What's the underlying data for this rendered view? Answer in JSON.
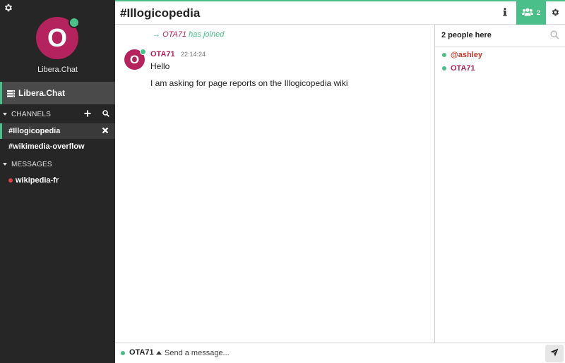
{
  "sidebar": {
    "avatar_letter": "O",
    "network_name": "Libera.Chat",
    "network_row_label": "Libera.Chat",
    "channels_header": "CHANNELS",
    "channels": [
      {
        "name": "#Illogicopedia",
        "active": true
      },
      {
        "name": "#wikimedia-overflow",
        "active": false
      }
    ],
    "messages_header": "MESSAGES",
    "queries": [
      {
        "name": "wikipedia-fr",
        "status_color": "#e04040"
      }
    ]
  },
  "header": {
    "channel_title": "#Illogicopedia",
    "people_count": "2"
  },
  "messages": {
    "join": {
      "nick": "OTA71",
      "text": "has joined"
    },
    "items": [
      {
        "avatar_letter": "O",
        "nick": "OTA71",
        "time": "22:14:24",
        "lines": [
          "Hello",
          "I am asking for page reports on the Illogicopedia wiki"
        ]
      }
    ]
  },
  "userlist": {
    "header": "2 people here",
    "users": [
      {
        "name": "@ashley",
        "color": "#c0392b"
      },
      {
        "name": "OTA71",
        "color": "#b5235e"
      }
    ]
  },
  "input": {
    "nick": "OTA71",
    "placeholder": "Send a message..."
  },
  "colors": {
    "accent": "#4bbf8a",
    "sidebar_bg": "#262626",
    "avatar": "#b5235e"
  },
  "icons": [
    "gear-icon",
    "server-icon",
    "plus-icon",
    "search-icon",
    "close-icon",
    "info-icon",
    "users-icon",
    "send-icon",
    "arrow-right-icon"
  ]
}
